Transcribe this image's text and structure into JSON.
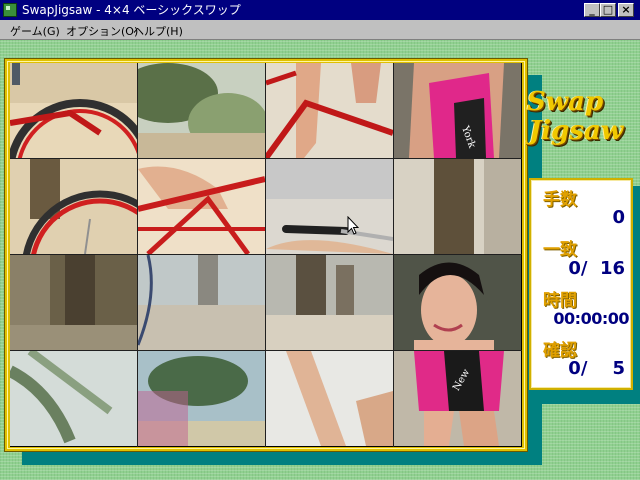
{
  "window": {
    "title": "SwapJigsaw - 4×4 ベーシックスワップ",
    "buttons": {
      "minimize_icon": "minimize-icon",
      "maximize_icon": "maximize-icon",
      "close_icon": "close-icon"
    }
  },
  "menu": {
    "items": [
      {
        "label": "ゲーム(G)"
      },
      {
        "label": "オプション(O)"
      },
      {
        "label": "ヘルプ(H)"
      }
    ]
  },
  "logo": {
    "line1": "Swap",
    "line2": "Jigsaw"
  },
  "stats": {
    "moves_label": "手数",
    "moves_value": "0",
    "match_label": "一致",
    "match_value": "0/  16",
    "time_label": "時間",
    "time_value": "00:00:00",
    "check_label": "確認",
    "check_value": "0/    5"
  },
  "puzzle": {
    "rows": 4,
    "cols": 4,
    "tiles": [
      {
        "content": "red bicycle wheel on beach sand"
      },
      {
        "content": "palm leaves blurred"
      },
      {
        "content": "legs and red bicycle frame"
      },
      {
        "content": "woman in pink swimsuit"
      },
      {
        "content": "red bicycle wheel and palm trunk"
      },
      {
        "content": "leg over red bicycle frame"
      },
      {
        "content": "bicycle handlebar on sand"
      },
      {
        "content": "palm trunk blurred"
      },
      {
        "content": "palm trunk shadows"
      },
      {
        "content": "bicycle wheel edge and beach"
      },
      {
        "content": "palm trunk and sand"
      },
      {
        "content": "smiling woman face"
      },
      {
        "content": "palm tree fronds and sky"
      },
      {
        "content": "palm fronds blurred"
      },
      {
        "content": "legs on white sand"
      },
      {
        "content": "pink swimsuit and legs"
      }
    ]
  },
  "colors": {
    "titlebar": "#000080",
    "background": "#90d090",
    "frame": "#e0c000",
    "teal_shadow": "#008080",
    "label": "#e0a000",
    "value": "#000080"
  }
}
